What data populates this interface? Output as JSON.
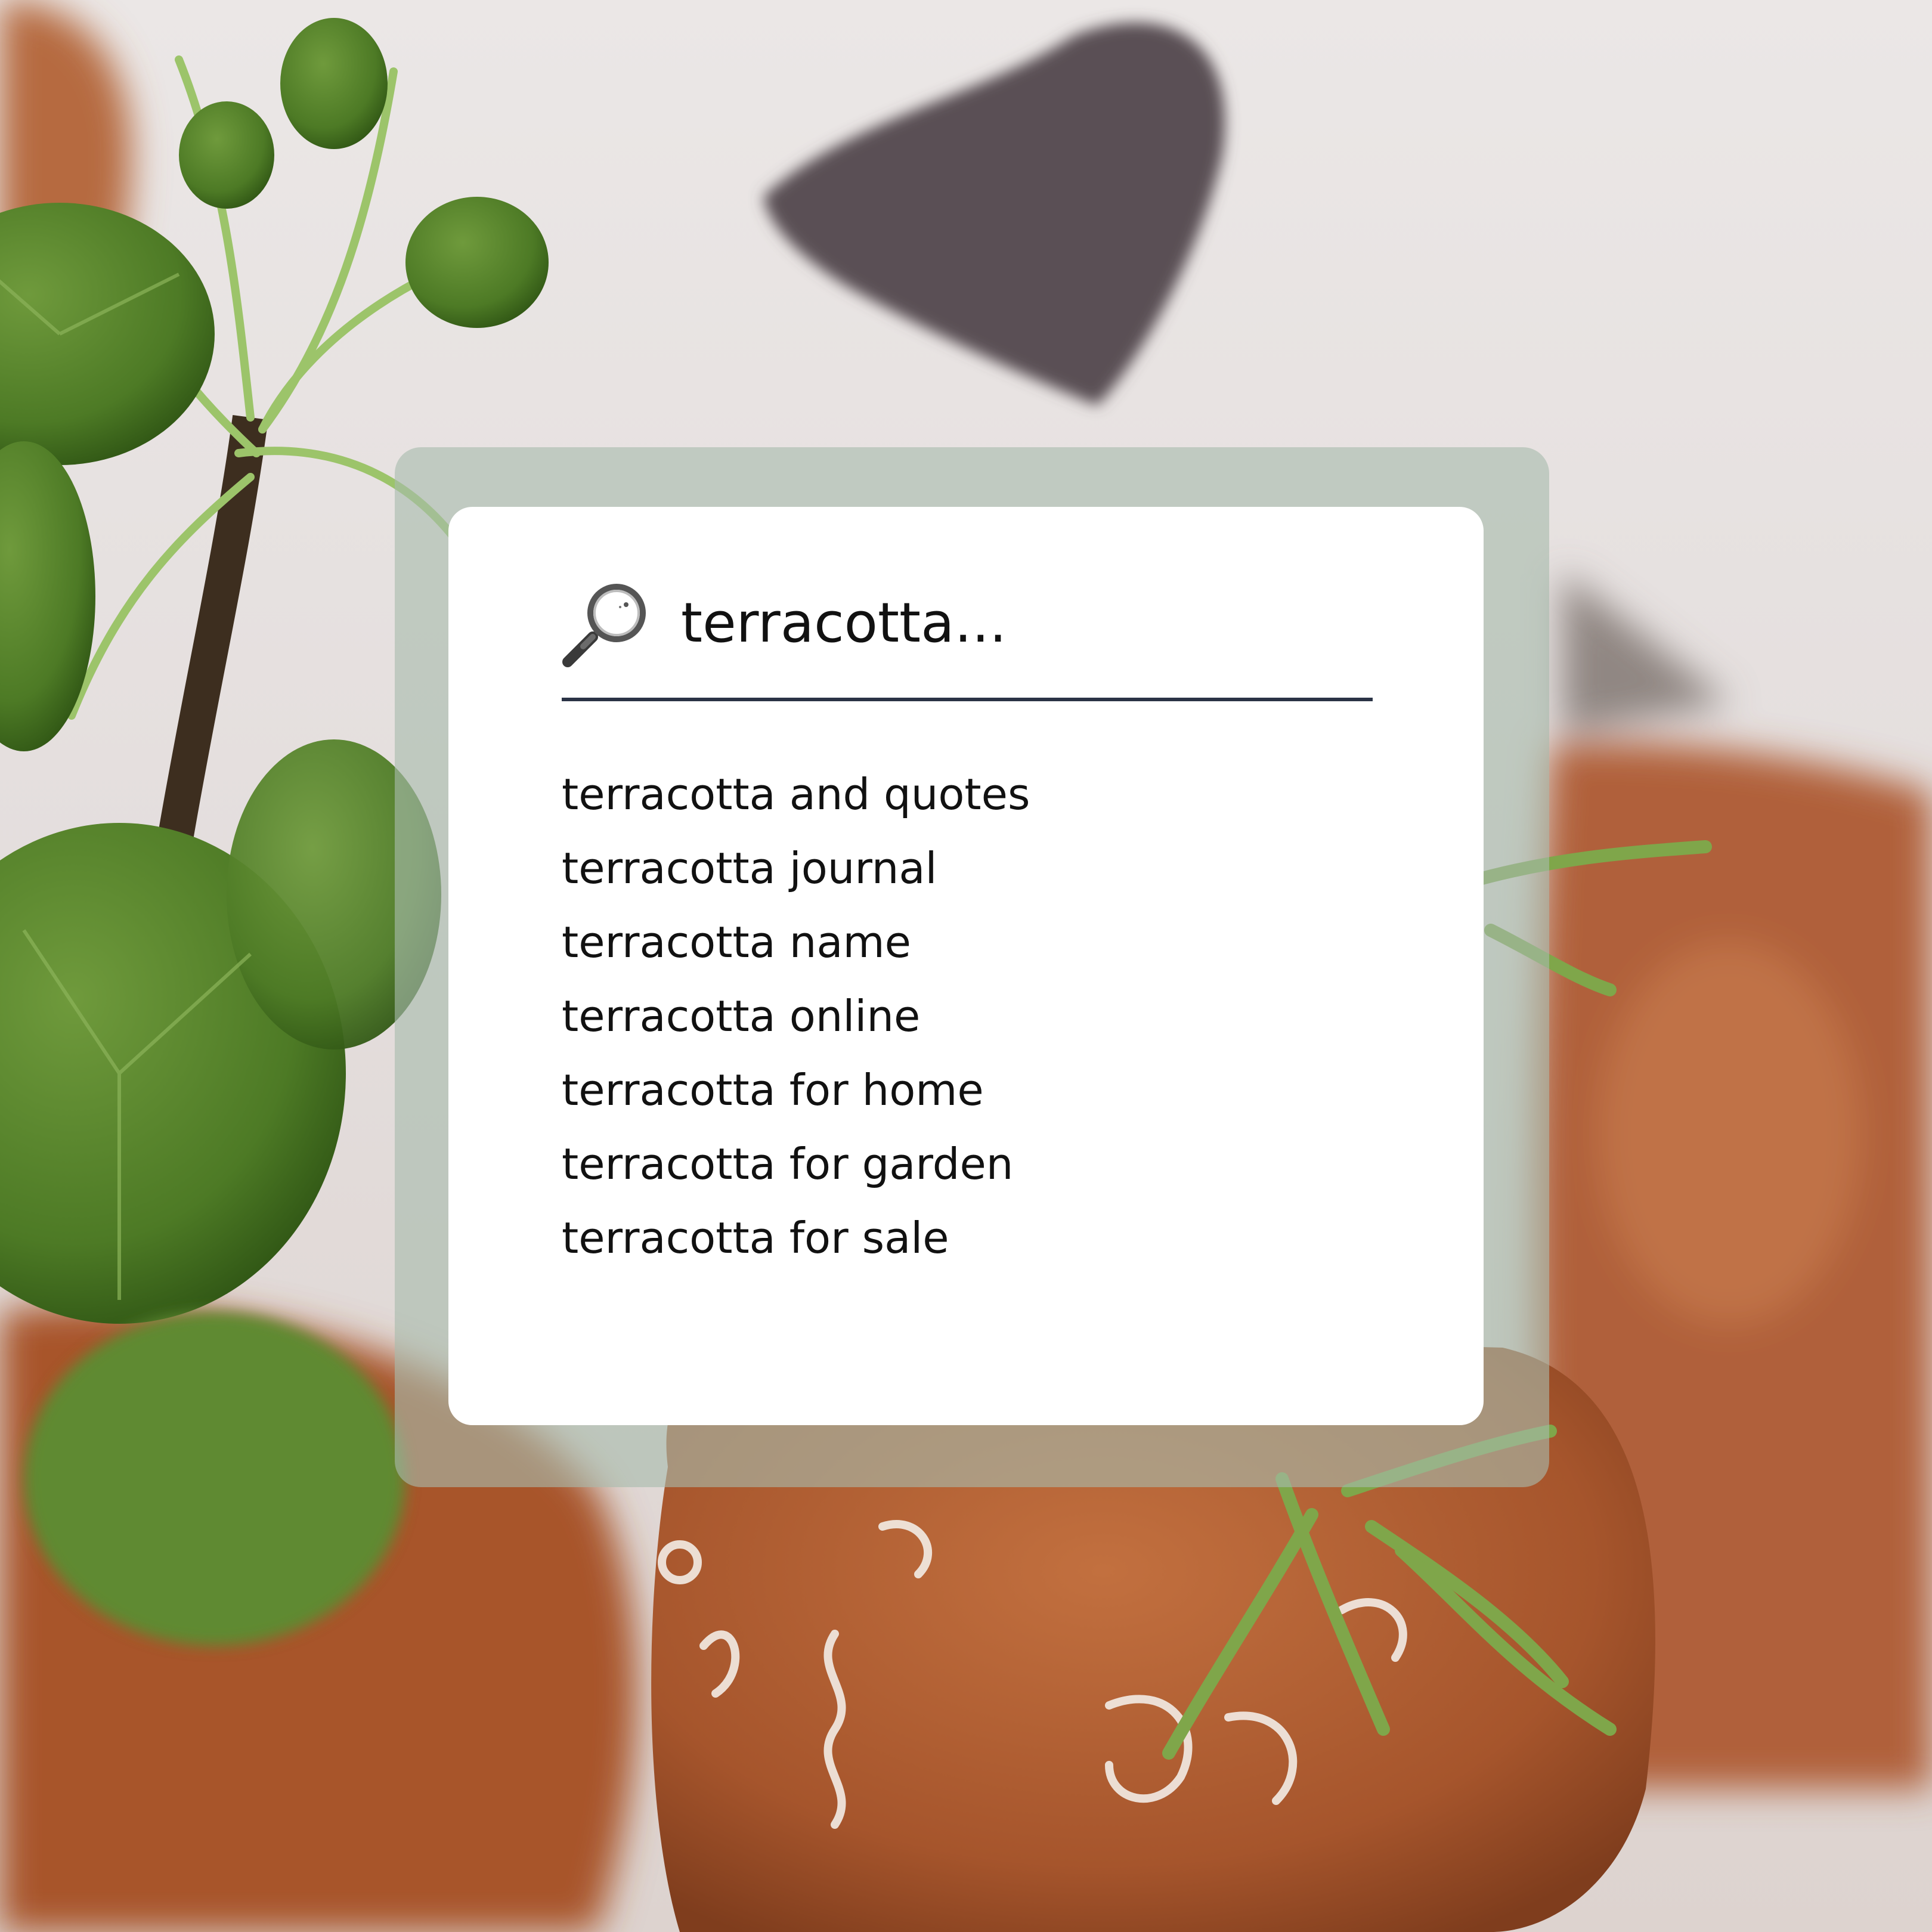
{
  "search": {
    "query": "terracotta...",
    "icon": "search-icon"
  },
  "suggestions": [
    "terracotta and quotes",
    "terracotta journal",
    "terracotta name",
    "terracotta online",
    "terracotta for home",
    "terracotta for garden",
    "terracotta for sale"
  ],
  "colors": {
    "panel": "#a8bcac",
    "card": "#ffffff",
    "underline": "#2b3346",
    "text": "#111111",
    "terracotta": "#b5623a"
  }
}
